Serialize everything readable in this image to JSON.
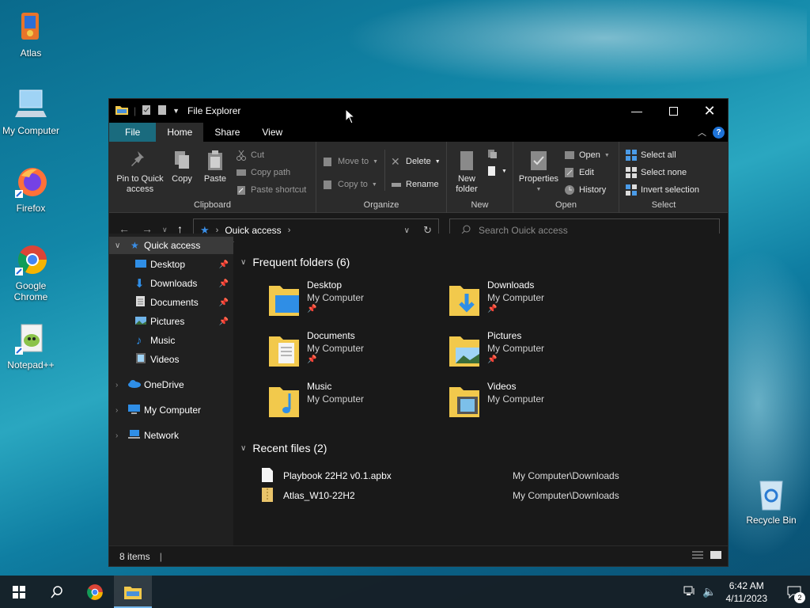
{
  "desktop": {
    "icons": [
      {
        "label": "Atlas",
        "icon": "atlas-icon"
      },
      {
        "label": "My Computer",
        "icon": "computer-icon"
      },
      {
        "label": "Firefox",
        "icon": "firefox-icon"
      },
      {
        "label": "Google Chrome",
        "icon": "chrome-icon"
      },
      {
        "label": "Notepad++",
        "icon": "notepadpp-icon"
      },
      {
        "label": "Recycle Bin",
        "icon": "recycle-bin-icon"
      }
    ]
  },
  "window": {
    "title": "File Explorer",
    "tabs": {
      "file": "File",
      "home": "Home",
      "share": "Share",
      "view": "View"
    },
    "help": "?",
    "ribbon": {
      "clipboard": {
        "title": "Clipboard",
        "pin_line1": "Pin to Quick",
        "pin_line2": "access",
        "copy": "Copy",
        "paste": "Paste",
        "cut": "Cut",
        "copy_path": "Copy path",
        "paste_shortcut": "Paste shortcut"
      },
      "organize": {
        "title": "Organize",
        "move_to": "Move to",
        "copy_to": "Copy to",
        "delete": "Delete",
        "rename": "Rename"
      },
      "new": {
        "title": "New",
        "new_line1": "New",
        "new_line2": "folder"
      },
      "open": {
        "title": "Open",
        "properties": "Properties",
        "open": "Open",
        "edit": "Edit",
        "history": "History"
      },
      "select": {
        "title": "Select",
        "select_all": "Select all",
        "select_none": "Select none",
        "invert": "Invert selection"
      }
    },
    "address": {
      "location": "Quick access"
    },
    "search": {
      "placeholder": "Search Quick access"
    },
    "nav": {
      "quick_access": "Quick access",
      "items": [
        "Desktop",
        "Downloads",
        "Documents",
        "Pictures",
        "Music",
        "Videos"
      ],
      "onedrive": "OneDrive",
      "my_computer": "My Computer",
      "network": "Network"
    },
    "frequent": {
      "header": "Frequent folders (6)",
      "folders": [
        {
          "name": "Desktop",
          "path": "My Computer"
        },
        {
          "name": "Downloads",
          "path": "My Computer"
        },
        {
          "name": "Documents",
          "path": "My Computer"
        },
        {
          "name": "Pictures",
          "path": "My Computer"
        },
        {
          "name": "Music",
          "path": "My Computer"
        },
        {
          "name": "Videos",
          "path": "My Computer"
        }
      ]
    },
    "recent": {
      "header": "Recent files (2)",
      "files": [
        {
          "name": "Playbook 22H2 v0.1.apbx",
          "path": "My Computer\\Downloads"
        },
        {
          "name": "Atlas_W10-22H2",
          "path": "My Computer\\Downloads"
        }
      ]
    },
    "status": {
      "items": "8 items"
    }
  },
  "taskbar": {
    "time": "6:42 AM",
    "date": "4/11/2023",
    "notifications": "2"
  },
  "colors": {
    "accent": "#1a6b7e",
    "folder": "#f2c94c",
    "window_bg": "#191919"
  }
}
